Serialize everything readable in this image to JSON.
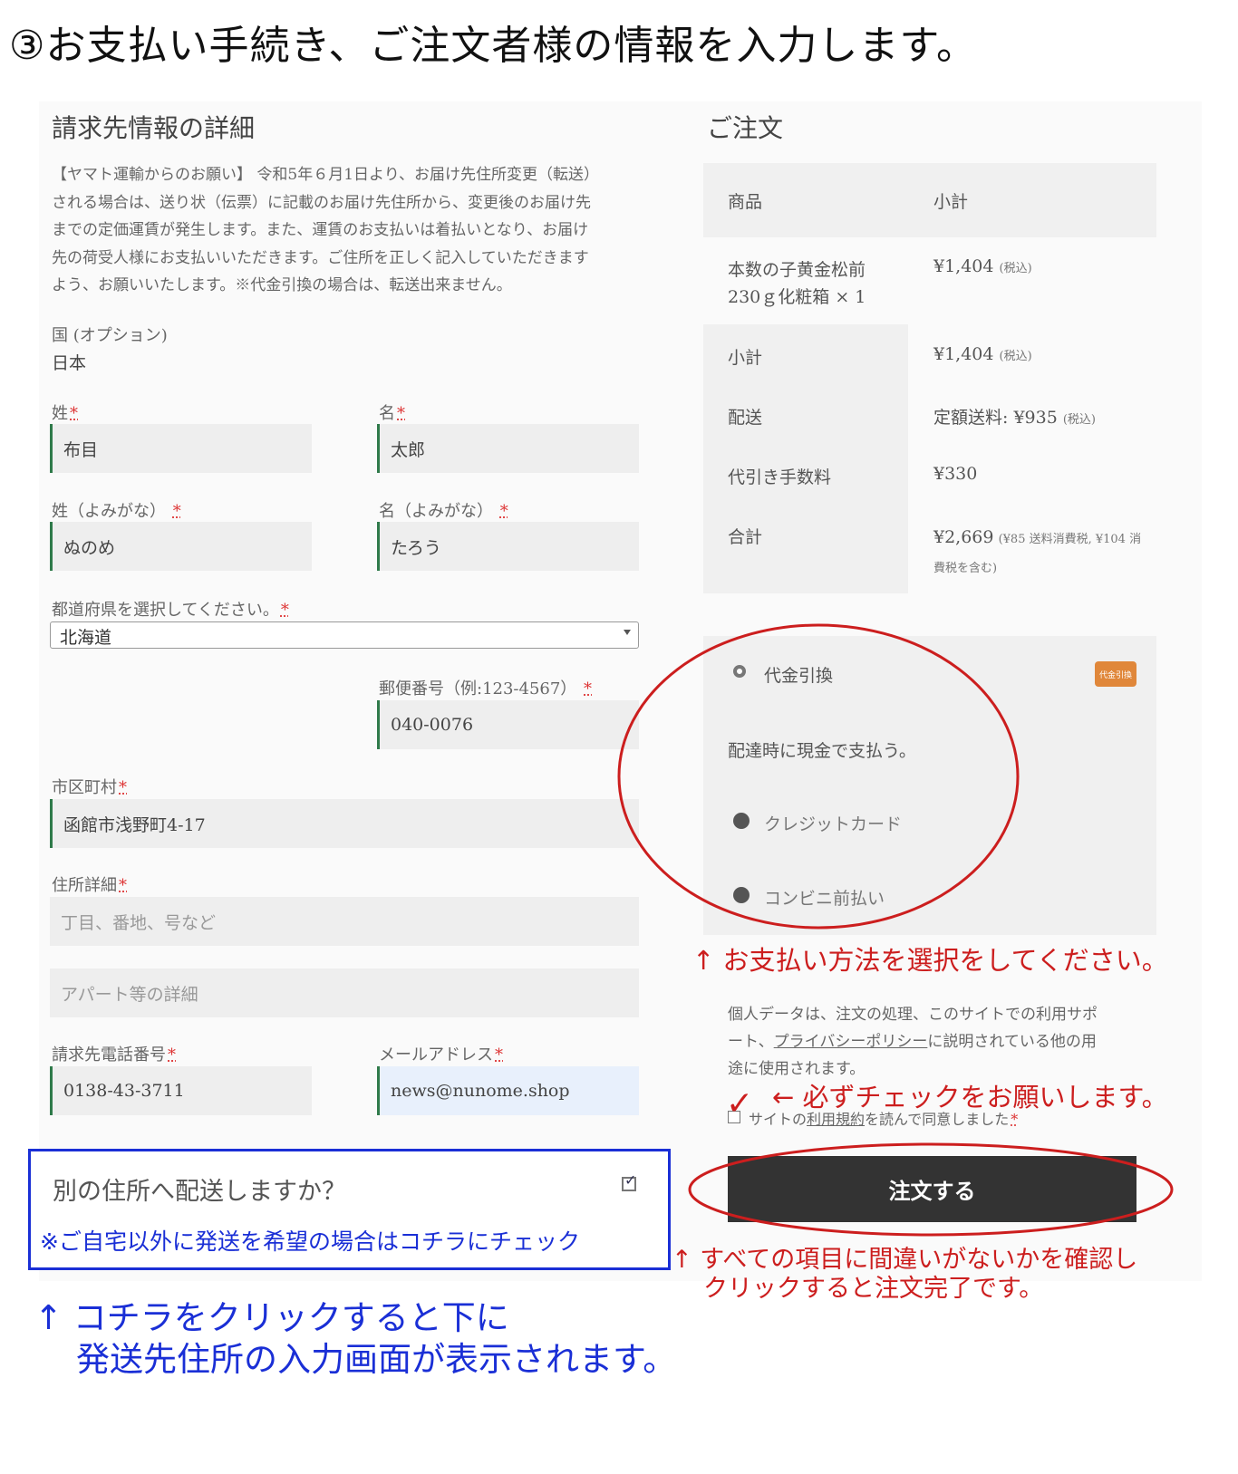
{
  "step_title": "③お支払い手続き、ご注文者様の情報を入力します。",
  "billing": {
    "title": "請求先情報の詳細",
    "notice_lines": [
      "【ヤマト運輸からのお願い】 令和5年６月1日より、お届け先住所変更（転送）",
      "される場合は、送り状（伝票）に記載のお届け先住所から、変更後のお届け先",
      "までの定価運賃が発生します。また、運賃のお支払いは着払いとなり、お届け",
      "先の荷受人様にお支払いいただきます。ご住所を正しく記入していただきます",
      "よう、お願いいたします。※代金引換の場合は、転送出来ません。"
    ],
    "country_label": "国 (オプション)",
    "country_value": "日本",
    "last_name_label": "姓",
    "last_name_value": "布目",
    "first_name_label": "名",
    "first_name_value": "太郎",
    "last_kana_label": "姓（よみがな）",
    "last_kana_value": "ぬのめ",
    "first_kana_label": "名（よみがな）",
    "first_kana_value": "たろう",
    "prefecture_label": "都道府県を選択してください。",
    "prefecture_value": "北海道",
    "postal_label": "郵便番号（例:123-4567）",
    "postal_value": "040-0076",
    "city_label": "市区町村",
    "city_value": "函館市浅野町4-17",
    "address_label": "住所詳細",
    "address_placeholder": "丁目、番地、号など",
    "apartment_placeholder": "アパート等の詳細",
    "phone_label": "請求先電話番号",
    "phone_value": "0138-43-3711",
    "email_label": "メールアドレス",
    "email_value": "news@nunome.shop",
    "required_mark": "*"
  },
  "ship_other": {
    "label": "別の住所へ配送しますか？",
    "checked": true,
    "note": "※ご自宅以外に発送を希望の場合はコチラにチェック"
  },
  "order": {
    "title": "ご注文",
    "col_product": "商品",
    "col_subtotal": "小計",
    "product_line1": "本数の子黄金松前",
    "product_line2": "230ｇ化粧箱",
    "product_qty": "× 1",
    "product_price": "¥1,404",
    "tax_incl": "(税込)",
    "subtotal_label": "小計",
    "subtotal_value": "¥1,404",
    "shipping_label": "配送",
    "shipping_value": "定額送料: ¥935",
    "cod_fee_label": "代引き手数料",
    "cod_fee_value": "¥330",
    "total_label": "合計",
    "total_value": "¥2,669",
    "total_note_1": "(¥85 送料消費税, ¥104 消",
    "total_note_2": "費税を含む)"
  },
  "payment": {
    "methods": [
      {
        "label": "代金引換",
        "selected": true,
        "badge": "代金引換"
      },
      {
        "label": "クレジットカード",
        "selected": false
      },
      {
        "label": "コンビニ前払い",
        "selected": false
      }
    ],
    "cod_description": "配達時に現金で支払う。"
  },
  "privacy": {
    "line1": "個人データは、注文の処理、このサイトでの利用サポ",
    "line2_pre": "ート、",
    "line2_link": "プライバシーポリシー",
    "line2_post": "に説明されている他の用",
    "line3": "途に使用されます。"
  },
  "terms": {
    "pre": "サイトの",
    "link": "利用規約",
    "post": "を読んで同意しました",
    "checked": true
  },
  "place_order_button": "注文する",
  "annotations": {
    "payment_select": "↑ お支払い方法を選択をしてください。",
    "check_terms": "← 必ずチェックをお願いします。",
    "check_mark": "✓",
    "confirm_line1": "↑ すべての項目に間違いがないかを確認し",
    "confirm_line2": "クリックすると注文完了です。",
    "ship_note_line1": "↑ コチラをクリックすると下に",
    "ship_note_line2": "発送先住所の入力画面が表示されます。"
  },
  "colors": {
    "accent_green": "#2f7a4a",
    "button_dark": "#333333",
    "annotation_red": "#cc1e1e",
    "annotation_blue": "#1a2fd6",
    "badge_orange": "#e0873a"
  }
}
